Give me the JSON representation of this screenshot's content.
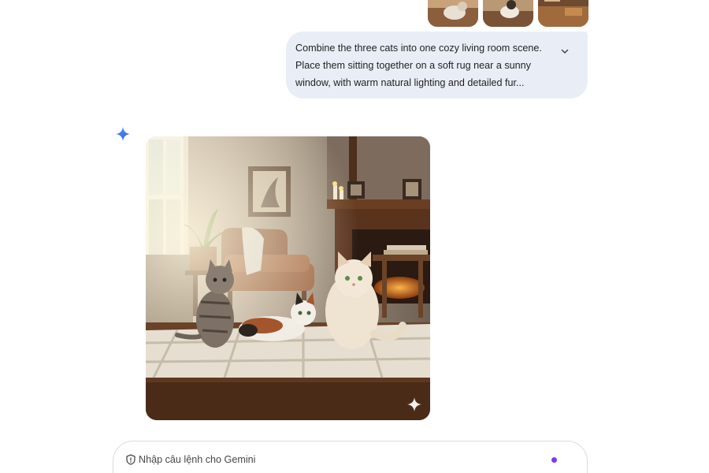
{
  "conversation": {
    "user_message": {
      "attachments": [
        {
          "name": "cat-photo-1",
          "description_icon": "image-thumbnail-icon"
        },
        {
          "name": "cat-photo-2",
          "description_icon": "image-thumbnail-icon"
        },
        {
          "name": "cat-photo-3",
          "description_icon": "image-thumbnail-icon"
        }
      ],
      "text": "Combine the three cats into one cozy living room scene. Place them sitting together on a soft rug near a sunny window, with warm natural lighting and detailed fur...",
      "expand_icon": "chevron-down-icon"
    },
    "assistant_message": {
      "avatar_icon": "gemini-spark-icon",
      "watermark_icon": "sparkle-watermark-icon"
    }
  },
  "composer": {
    "placeholder": "Nhập câu lệnh cho Gemini",
    "icon": "shield-icon"
  },
  "colors": {
    "user_bubble": "#e9eef6",
    "gemini_blue": "#4285f4",
    "accent_purple": "#7c3aed"
  }
}
